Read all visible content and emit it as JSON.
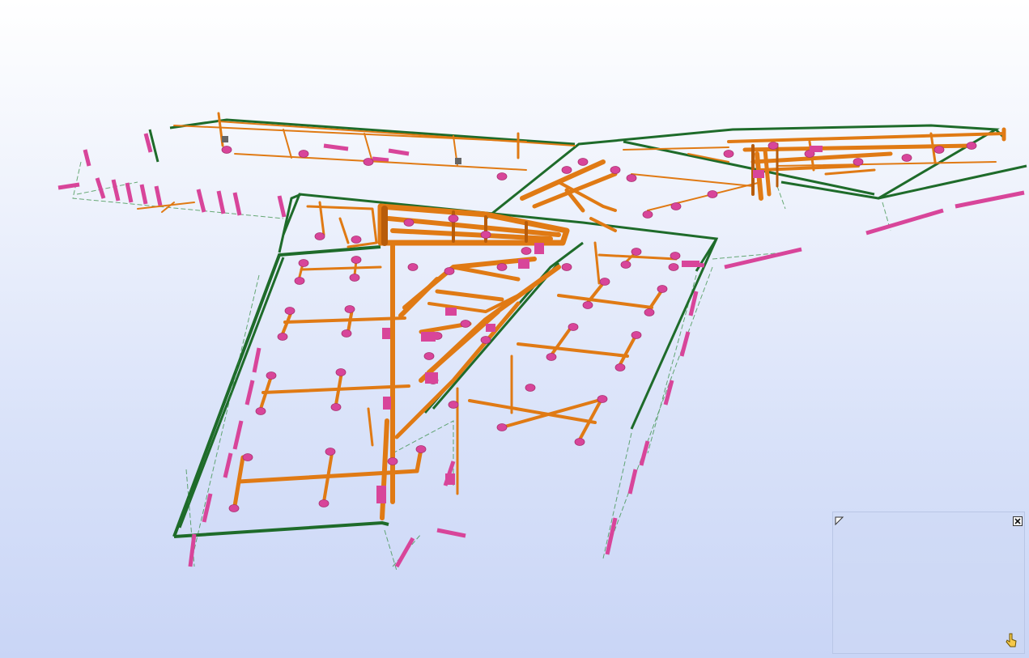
{
  "viewer": {
    "background_top": "#ffffff",
    "background_bottom": "#c9d5f6"
  },
  "colors": {
    "pipe": "#e07a14",
    "pipe_dark": "#b85c0a",
    "fixture": "#d8459a",
    "outline": "#1e6b2a"
  },
  "mini_panel": {
    "resize_icon": "resize-corner-icon",
    "close_icon": "close-icon",
    "pointer_icon": "pointer-cursor-icon"
  }
}
